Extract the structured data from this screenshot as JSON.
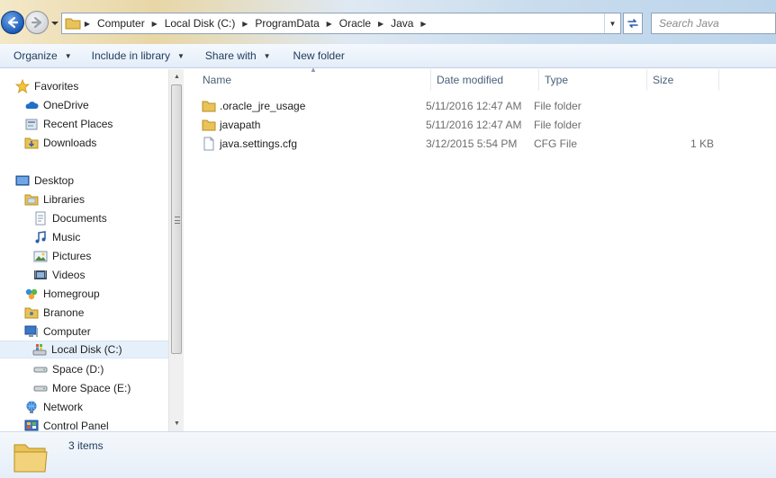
{
  "address": {
    "breadcrumbs": [
      "Computer",
      "Local Disk (C:)",
      "ProgramData",
      "Oracle",
      "Java"
    ],
    "search_placeholder": "Search Java"
  },
  "toolbar": {
    "organize": "Organize",
    "include_in_library": "Include in library",
    "share_with": "Share with",
    "new_folder": "New folder"
  },
  "nav": {
    "favorites": "Favorites",
    "onedrive": "OneDrive",
    "recent_places": "Recent Places",
    "downloads": "Downloads",
    "desktop": "Desktop",
    "libraries": "Libraries",
    "documents": "Documents",
    "music": "Music",
    "pictures": "Pictures",
    "videos": "Videos",
    "homegroup": "Homegroup",
    "branone": "Branone",
    "computer": "Computer",
    "local_disk_c": "Local Disk (C:)",
    "space_d": "Space (D:)",
    "more_space_e": "More Space (E:)",
    "network": "Network",
    "control_panel": "Control Panel"
  },
  "columns": {
    "name": "Name",
    "date_modified": "Date modified",
    "type": "Type",
    "size": "Size"
  },
  "files": [
    {
      "name": ".oracle_jre_usage",
      "date": "5/11/2016 12:47 AM",
      "type": "File folder",
      "size": "",
      "icon": "folder-icon"
    },
    {
      "name": "javapath",
      "date": "5/11/2016 12:47 AM",
      "type": "File folder",
      "size": "",
      "icon": "folder-icon"
    },
    {
      "name": "java.settings.cfg",
      "date": "3/12/2015 5:54 PM",
      "type": "CFG File",
      "size": "1 KB",
      "icon": "file-icon"
    }
  ],
  "status": {
    "items_count": "3 items"
  },
  "colors": {
    "selection": "#e6f0fb",
    "toolbar_text": "#1e395b",
    "header_text": "#4c607a"
  }
}
